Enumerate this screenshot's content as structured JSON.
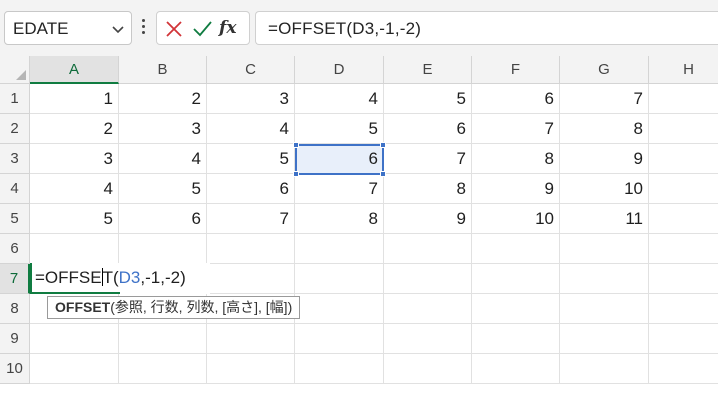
{
  "name_box": {
    "value": "EDATE",
    "icon": "chevron-down-icon"
  },
  "formula_bar": {
    "formula": "=OFFSET(D3,-1,-2)",
    "cancel_icon": "close-icon",
    "enter_icon": "check-icon",
    "function_label": "fx"
  },
  "columns": [
    "A",
    "B",
    "C",
    "D",
    "E",
    "F",
    "G",
    "H"
  ],
  "rows": [
    "1",
    "2",
    "3",
    "4",
    "5",
    "6",
    "7",
    "8",
    "9",
    "10"
  ],
  "cells": [
    [
      "1",
      "2",
      "3",
      "4",
      "5",
      "6",
      "7"
    ],
    [
      "2",
      "3",
      "4",
      "5",
      "6",
      "7",
      "8"
    ],
    [
      "3",
      "4",
      "5",
      "6",
      "7",
      "8",
      "9"
    ],
    [
      "4",
      "5",
      "6",
      "7",
      "8",
      "9",
      "10"
    ],
    [
      "5",
      "6",
      "7",
      "8",
      "9",
      "10",
      "11"
    ]
  ],
  "active_cell": "D3",
  "editing": {
    "cell": "A7",
    "text_before_caret": "=OFFSE",
    "text_after_caret": "T(",
    "reference": "D3",
    "text_after_ref": ",-1,-2)"
  },
  "tooltip": {
    "function_name": "OFFSET",
    "args": "(参照, 行数, 列数, [高さ], [幅])"
  },
  "colors": {
    "accent_green": "#107c41",
    "selection_blue": "#3e72c7",
    "cancel_red": "#d13438",
    "enter_green": "#107c41"
  }
}
